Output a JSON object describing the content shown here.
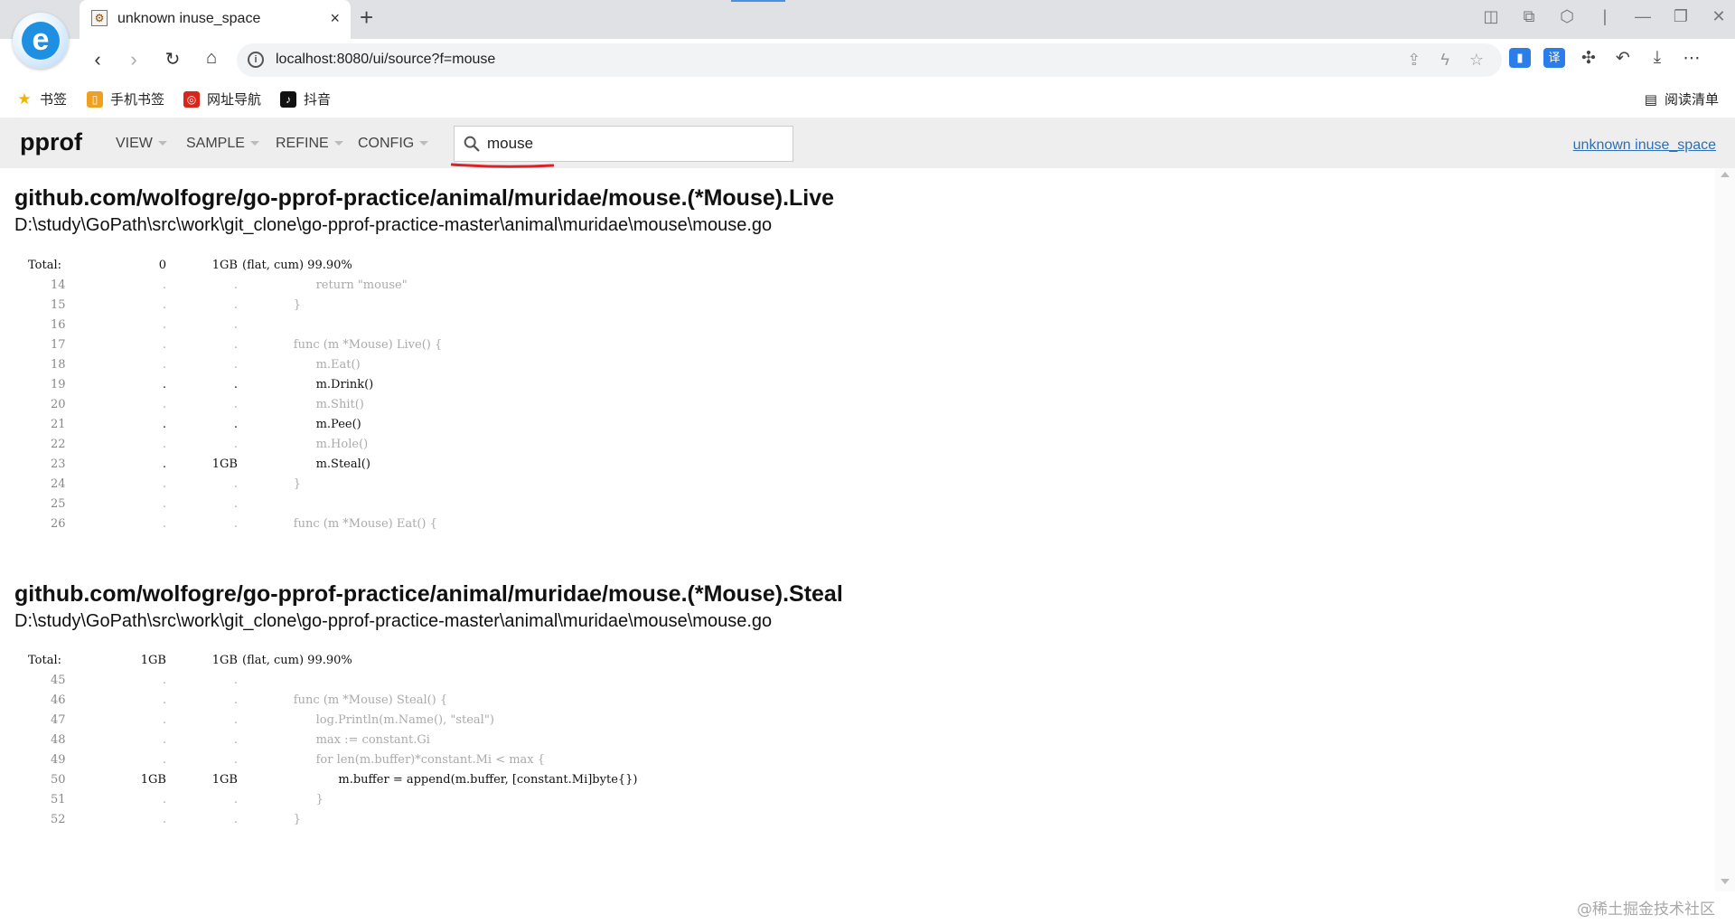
{
  "browser": {
    "tab_title": "unknown inuse_space",
    "tab_close": "×",
    "new_tab": "+",
    "address": "localhost:8080/ui/source?f=mouse",
    "address_info": "i",
    "bookmarks": [
      {
        "label": "书签",
        "icon": "star-icon",
        "color": "#f5b400"
      },
      {
        "label": "手机书签",
        "icon": "mobile-bookmark-icon",
        "color": "#f0a020"
      },
      {
        "label": "网址导航",
        "icon": "navigation-icon",
        "color": "#d8261a"
      },
      {
        "label": "抖音",
        "icon": "douyin-icon",
        "color": "#111111"
      }
    ],
    "reading_list": "阅读清单",
    "translate_ext": "译"
  },
  "pprof": {
    "title": "pprof",
    "menus": [
      "VIEW",
      "SAMPLE",
      "REFINE",
      "CONFIG"
    ],
    "search_value": "mouse",
    "profile_link": "unknown inuse_space"
  },
  "sources": [
    {
      "function": "github.com/wolfogre/go-pprof-practice/animal/muridae/mouse.(*Mouse).Live",
      "file": "D:\\study\\GoPath\\src\\work\\git_clone\\go-pprof-practice-master\\animal\\muridae\\mouse\\mouse.go",
      "total": {
        "label": "Total:",
        "flat": "0",
        "cum": "1GB",
        "summary": "(flat, cum) 99.90%"
      },
      "lines": [
        {
          "ln": "14",
          "flat": ".",
          "cum": ".",
          "code": "\t\treturn \"mouse\"",
          "hot": false
        },
        {
          "ln": "15",
          "flat": ".",
          "cum": ".",
          "code": "\t}",
          "hot": false
        },
        {
          "ln": "16",
          "flat": ".",
          "cum": ".",
          "code": "",
          "hot": false
        },
        {
          "ln": "17",
          "flat": ".",
          "cum": ".",
          "code": "\tfunc (m *Mouse) Live() {",
          "hot": false
        },
        {
          "ln": "18",
          "flat": ".",
          "cum": ".",
          "code": "\t\tm.Eat()",
          "hot": false
        },
        {
          "ln": "19",
          "flat": ".",
          "cum": ".",
          "code": "\t\tm.Drink()",
          "hot": true
        },
        {
          "ln": "20",
          "flat": ".",
          "cum": ".",
          "code": "\t\tm.Shit()",
          "hot": false
        },
        {
          "ln": "21",
          "flat": ".",
          "cum": ".",
          "code": "\t\tm.Pee()",
          "hot": true
        },
        {
          "ln": "22",
          "flat": ".",
          "cum": ".",
          "code": "\t\tm.Hole()",
          "hot": false
        },
        {
          "ln": "23",
          "flat": ".",
          "cum": "1GB",
          "code": "\t\tm.Steal()",
          "hot": true
        },
        {
          "ln": "24",
          "flat": ".",
          "cum": ".",
          "code": "\t}",
          "hot": false
        },
        {
          "ln": "25",
          "flat": ".",
          "cum": ".",
          "code": "",
          "hot": false
        },
        {
          "ln": "26",
          "flat": ".",
          "cum": ".",
          "code": "\tfunc (m *Mouse) Eat() {",
          "hot": false
        }
      ]
    },
    {
      "function": "github.com/wolfogre/go-pprof-practice/animal/muridae/mouse.(*Mouse).Steal",
      "file": "D:\\study\\GoPath\\src\\work\\git_clone\\go-pprof-practice-master\\animal\\muridae\\mouse\\mouse.go",
      "total": {
        "label": "Total:",
        "flat": "1GB",
        "cum": "1GB",
        "summary": "(flat, cum) 99.90%"
      },
      "lines": [
        {
          "ln": "45",
          "flat": ".",
          "cum": ".",
          "code": "",
          "hot": false
        },
        {
          "ln": "46",
          "flat": ".",
          "cum": ".",
          "code": "\tfunc (m *Mouse) Steal() {",
          "hot": false
        },
        {
          "ln": "47",
          "flat": ".",
          "cum": ".",
          "code": "\t\tlog.Println(m.Name(), \"steal\")",
          "hot": false
        },
        {
          "ln": "48",
          "flat": ".",
          "cum": ".",
          "code": "\t\tmax := constant.Gi",
          "hot": false
        },
        {
          "ln": "49",
          "flat": ".",
          "cum": ".",
          "code": "\t\tfor len(m.buffer)*constant.Mi < max {",
          "hot": false
        },
        {
          "ln": "50",
          "flat": "1GB",
          "cum": "1GB",
          "code": "\t\t\tm.buffer = append(m.buffer, [constant.Mi]byte{})",
          "hot": true
        },
        {
          "ln": "51",
          "flat": ".",
          "cum": ".",
          "code": "\t\t}",
          "hot": false
        },
        {
          "ln": "52",
          "flat": ".",
          "cum": ".",
          "code": "\t}",
          "hot": false
        }
      ]
    }
  ],
  "watermark": "@稀土掘金技术社区"
}
